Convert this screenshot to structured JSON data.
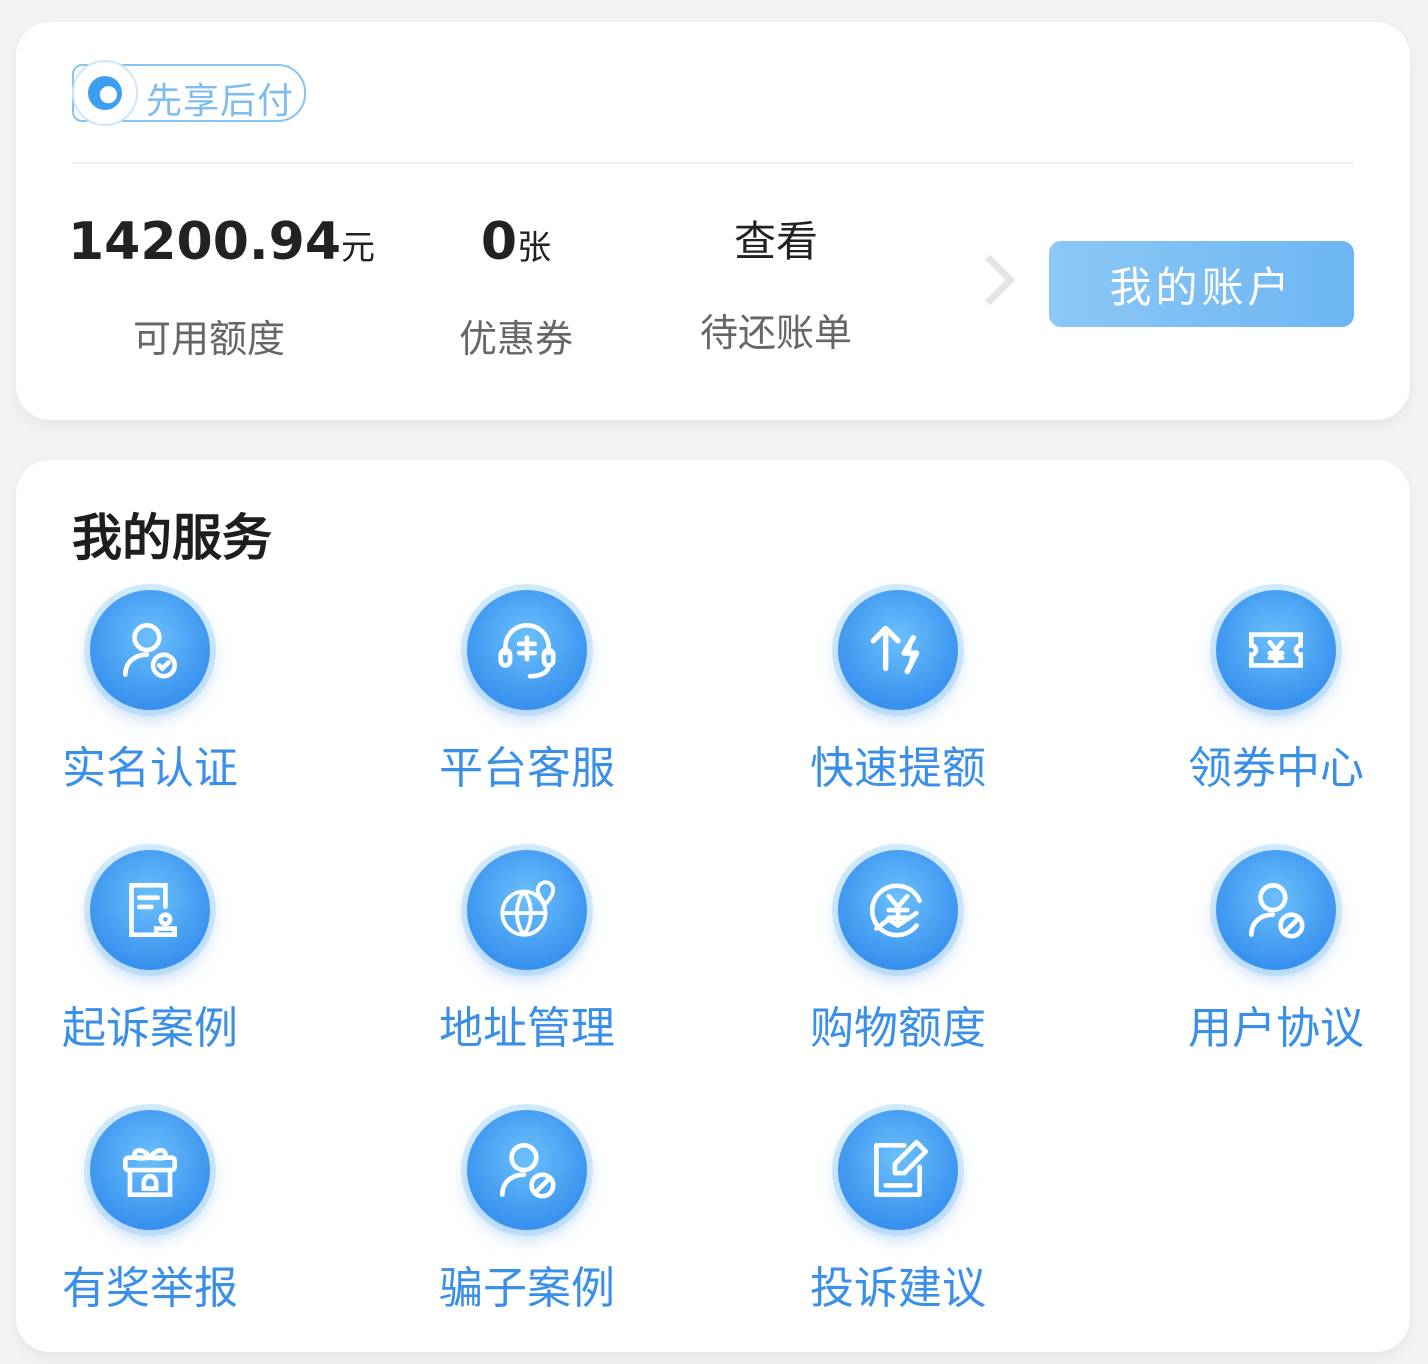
{
  "account": {
    "badge_label": "先享后付",
    "limit": {
      "value": "14200.94",
      "unit": "元",
      "label": "可用额度"
    },
    "coupon": {
      "value": "0",
      "unit": "张",
      "label": "优惠券"
    },
    "bill": {
      "value": "查看",
      "label": "待还账单"
    },
    "my_account_button": "我的账户"
  },
  "services": {
    "title": "我的服务",
    "items": [
      {
        "label": "实名认证",
        "icon": "user-verified-icon"
      },
      {
        "label": "平台客服",
        "icon": "headset-icon"
      },
      {
        "label": "快速提额",
        "icon": "arrow-lightning-icon"
      },
      {
        "label": "领券中心",
        "icon": "ticket-yen-icon"
      },
      {
        "label": "起诉案例",
        "icon": "document-stamp-icon"
      },
      {
        "label": "地址管理",
        "icon": "globe-pin-icon"
      },
      {
        "label": "购物额度",
        "icon": "yen-refresh-icon"
      },
      {
        "label": "用户协议",
        "icon": "user-block-icon"
      },
      {
        "label": "有奖举报",
        "icon": "gift-box-icon"
      },
      {
        "label": "骗子案例",
        "icon": "user-block-icon"
      },
      {
        "label": "投诉建议",
        "icon": "edit-note-icon"
      }
    ]
  }
}
